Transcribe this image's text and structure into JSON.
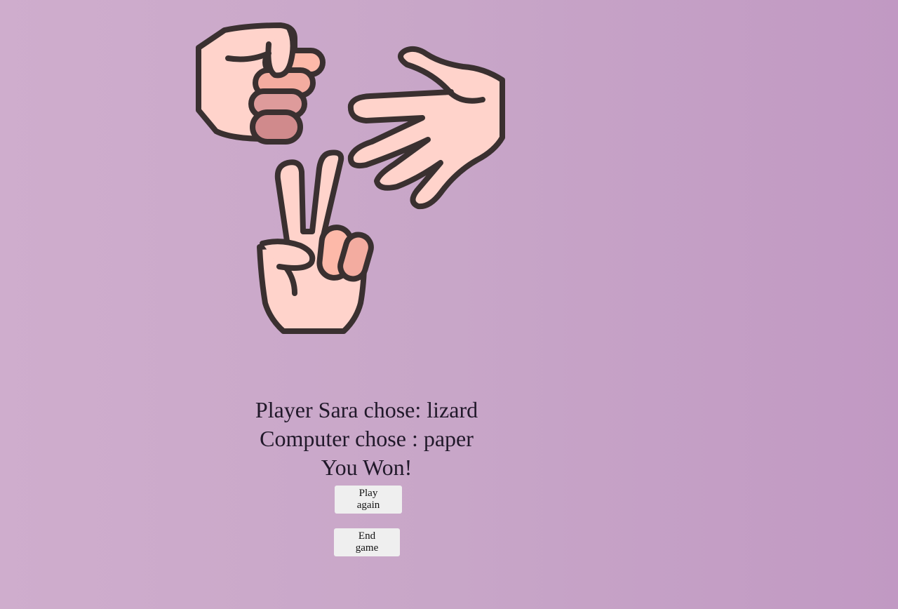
{
  "result": {
    "player_line": "Player Sara chose: lizard",
    "computer_line": "Computer chose : paper",
    "outcome": "You Won!"
  },
  "buttons": {
    "play_again": "Play again",
    "end_game": "End game"
  },
  "illustration": {
    "icons": [
      "fist-rock-icon",
      "open-hand-paper-icon",
      "victory-scissors-icon"
    ],
    "colors": {
      "outline": "#3a3030",
      "skin": "#ffd3cb",
      "finger_1": "#fdb9a9",
      "finger_2": "#f3aca0",
      "finger_3": "#de9b9b",
      "finger_4": "#d08a8c"
    }
  },
  "theme": {
    "background_start": "#cfadcd",
    "background_end": "#c199c3",
    "text": "#21192a",
    "button_bg": "#efefef"
  }
}
